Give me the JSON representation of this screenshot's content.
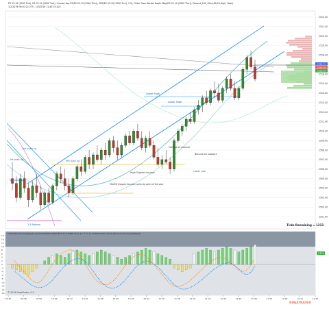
{
  "header": {
    "line1": "ES 03-19 (2000 Tick), ES 03-19 (2000 Tick), Current day ES(ES 03-19 (2000 Tick)), ERS(ES 03-19 (2000 Tick), 2.5), Order Flow Market Depth Map(ES 03-19 (2000 Tick)), Percent_200, False,80,20,High, False)",
    "line2": "1/2/2019 09:40:22.375 - 1/2/2019 11:42:19.425"
  },
  "right_ticks": [
    "2522.00",
    "2521.00",
    "2520.00",
    "2519.00",
    "2518.00",
    "2517.00",
    "2516.00",
    "2515.00",
    "2514.00",
    "2513.00",
    "2512.00",
    "2511.00",
    "2510.00",
    "2509.00",
    "2508.00",
    "2507.00",
    "2506.00",
    "2505.00",
    "2504.00",
    "2503.00",
    "2502.00",
    "2501.00"
  ],
  "price_badges": [
    {
      "text": "2515.75",
      "color": "#4169e1"
    },
    {
      "text": "2515.50",
      "color": "#e06060"
    },
    {
      "text": "2515.25",
      "color": "#3cb043"
    }
  ],
  "annotations": {
    "lower_high_1": "Lower High",
    "lower_high_2": "Lower High",
    "push_1st": "1st push up",
    "push_2nd": "2nd push up",
    "push_3rd": "3rd push up",
    "push_4th": "4th push up",
    "high_support": "High Support bounce",
    "failed_support": "FAILED Support bounce, pulls its cock all the way",
    "fail_change": "Fail out of channel",
    "bounce_support": "Bounce on support",
    "lower_low": "Lower Low",
    "low_label": "2.5   Bottom"
  },
  "ticks_remaining": "Ticks Remaining = 1313",
  "indicator": {
    "title": "InstantTrendlines(HappyHungryGhostSatOscillator(ES 03-19 (2000 Tick), 14, 3, 3, 3), SmStochastic_Trend_Trend_14_TurnLog_Multiplier",
    "value_badge": "1.521",
    "y_ticks": [
      "16",
      "14",
      "12",
      "10",
      "8",
      "6",
      "4",
      "2",
      "0",
      "-2",
      "-4",
      "-6",
      "-8",
      "-10",
      "-12",
      "-14",
      "-16"
    ]
  },
  "time_ticks": [
    "09:40",
    "09:48",
    "09:56",
    "10:04",
    "10:12",
    "10:20",
    "10:28",
    "10:36",
    "10:44",
    "10:52",
    "11:00",
    "11:08",
    "11:16",
    "11:24",
    "11:32",
    "11:40",
    "11:48",
    "11:56",
    "12:04",
    "12:12",
    "12:20"
  ],
  "copyright": "© 2019 NinjaTrader, LLC",
  "watermark": "NINJATRADER",
  "colors": {
    "up": "#2e8b2e",
    "down": "#c0392b",
    "channel": "#1e90ff",
    "ma": "#5ab8c8",
    "accent": "#ff8c00"
  },
  "chart_data": {
    "type": "candlestick",
    "ylim": [
      2500,
      2522.5
    ],
    "ohlc": [
      [
        2505.0,
        2506.75,
        2503.75,
        2504.5
      ],
      [
        2504.5,
        2505.25,
        2502.5,
        2503.0
      ],
      [
        2503.0,
        2505.5,
        2502.75,
        2505.0
      ],
      [
        2505.0,
        2505.75,
        2503.5,
        2504.0
      ],
      [
        2504.0,
        2504.5,
        2502.0,
        2502.75
      ],
      [
        2502.75,
        2504.75,
        2502.5,
        2504.25
      ],
      [
        2504.25,
        2505.5,
        2503.0,
        2503.5
      ],
      [
        2503.5,
        2504.25,
        2501.75,
        2502.25
      ],
      [
        2502.25,
        2503.75,
        2502.0,
        2503.5
      ],
      [
        2503.5,
        2504.0,
        2502.25,
        2502.5
      ],
      [
        2502.5,
        2504.5,
        2502.25,
        2504.25
      ],
      [
        2504.25,
        2505.75,
        2503.75,
        2505.5
      ],
      [
        2505.5,
        2506.25,
        2504.5,
        2505.0
      ],
      [
        2505.0,
        2506.0,
        2503.75,
        2504.25
      ],
      [
        2504.25,
        2505.0,
        2503.0,
        2503.5
      ],
      [
        2503.5,
        2505.25,
        2503.25,
        2505.0
      ],
      [
        2505.0,
        2506.5,
        2504.75,
        2506.25
      ],
      [
        2506.25,
        2507.0,
        2505.25,
        2505.75
      ],
      [
        2505.75,
        2507.5,
        2505.5,
        2507.25
      ],
      [
        2507.25,
        2508.0,
        2506.0,
        2506.5
      ],
      [
        2506.5,
        2507.75,
        2506.0,
        2507.5
      ],
      [
        2507.5,
        2508.5,
        2506.75,
        2507.0
      ],
      [
        2507.0,
        2508.25,
        2506.5,
        2508.0
      ],
      [
        2508.0,
        2508.75,
        2507.0,
        2507.5
      ],
      [
        2507.5,
        2509.25,
        2507.25,
        2509.0
      ],
      [
        2509.0,
        2509.5,
        2507.75,
        2508.25
      ],
      [
        2508.25,
        2509.0,
        2507.0,
        2507.5
      ],
      [
        2507.5,
        2508.75,
        2507.25,
        2508.5
      ],
      [
        2508.5,
        2509.75,
        2508.25,
        2509.5
      ],
      [
        2509.5,
        2510.0,
        2508.5,
        2508.75
      ],
      [
        2508.75,
        2510.25,
        2508.5,
        2510.0
      ],
      [
        2510.0,
        2510.75,
        2509.0,
        2509.25
      ],
      [
        2509.25,
        2510.0,
        2508.0,
        2508.25
      ],
      [
        2508.25,
        2509.5,
        2507.75,
        2509.25
      ],
      [
        2509.25,
        2510.0,
        2508.25,
        2508.5
      ],
      [
        2508.5,
        2509.0,
        2507.0,
        2507.25
      ],
      [
        2507.25,
        2508.25,
        2506.25,
        2506.5
      ],
      [
        2506.5,
        2507.5,
        2506.0,
        2507.0
      ],
      [
        2507.0,
        2508.0,
        2506.5,
        2506.75
      ],
      [
        2506.75,
        2507.25,
        2505.5,
        2506.0
      ],
      [
        2506.0,
        2509.25,
        2505.75,
        2509.0
      ],
      [
        2509.0,
        2510.25,
        2508.75,
        2510.0
      ],
      [
        2510.0,
        2510.75,
        2509.5,
        2510.5
      ],
      [
        2510.5,
        2511.5,
        2510.0,
        2511.25
      ],
      [
        2511.25,
        2512.0,
        2510.75,
        2511.0
      ],
      [
        2511.0,
        2512.5,
        2510.75,
        2512.25
      ],
      [
        2512.25,
        2513.25,
        2511.75,
        2512.75
      ],
      [
        2512.75,
        2513.75,
        2512.0,
        2513.5
      ],
      [
        2513.5,
        2514.25,
        2512.75,
        2513.0
      ],
      [
        2513.0,
        2514.5,
        2512.75,
        2514.25
      ],
      [
        2514.25,
        2515.25,
        2513.5,
        2514.0
      ],
      [
        2514.0,
        2515.0,
        2513.0,
        2513.25
      ],
      [
        2513.25,
        2514.75,
        2513.0,
        2514.5
      ],
      [
        2514.5,
        2515.75,
        2514.0,
        2515.5
      ],
      [
        2515.5,
        2516.0,
        2514.25,
        2514.5
      ],
      [
        2514.5,
        2515.25,
        2513.25,
        2513.5
      ],
      [
        2513.5,
        2514.75,
        2513.25,
        2514.5
      ],
      [
        2514.5,
        2516.75,
        2514.25,
        2516.5
      ],
      [
        2516.5,
        2518.0,
        2516.0,
        2517.75
      ],
      [
        2517.75,
        2518.5,
        2516.5,
        2516.75
      ],
      [
        2516.75,
        2517.5,
        2515.25,
        2515.5
      ]
    ],
    "histogram": [
      -2,
      -3,
      -4,
      -5,
      -6,
      -4,
      -2,
      0,
      2,
      4,
      5,
      6,
      5,
      4,
      6,
      7,
      8,
      7,
      6,
      5,
      6,
      7,
      8,
      7,
      6,
      5,
      4,
      3,
      4,
      5,
      6,
      7,
      8,
      9,
      8,
      7,
      6,
      5,
      4,
      3,
      -2,
      -3,
      -4,
      -3,
      -2,
      6,
      7,
      8,
      9,
      8,
      7,
      8,
      9,
      10,
      9,
      8,
      7,
      8,
      9,
      10,
      11
    ]
  }
}
